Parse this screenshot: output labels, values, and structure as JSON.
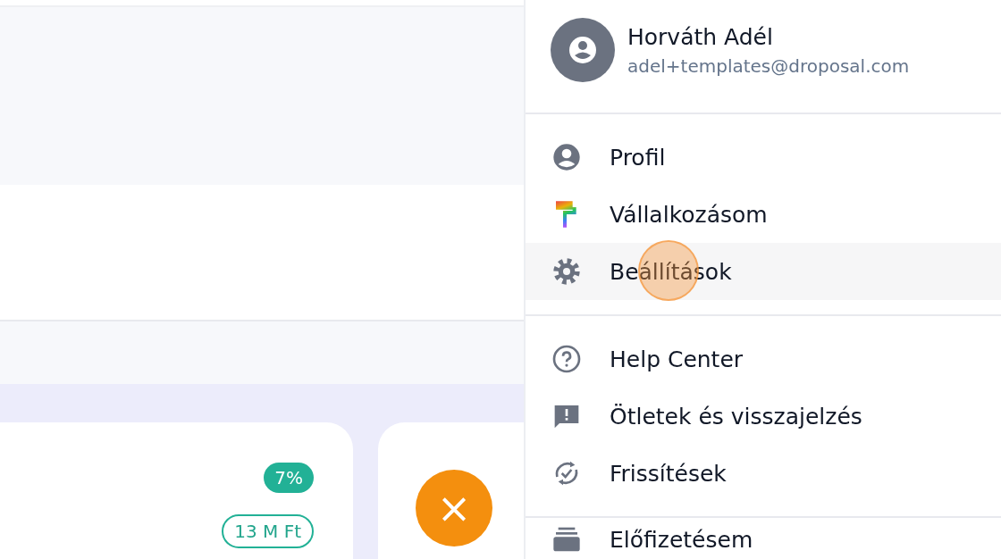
{
  "cards": [
    {
      "badges": [
        {
          "text": "7%",
          "kind": "filled"
        },
        {
          "text": "13 M Ft",
          "kind": "outlined"
        }
      ]
    },
    {
      "action": "×"
    }
  ],
  "account_menu": {
    "user": {
      "name": "Horváth Adél",
      "email": "adel+templates@droposal.com"
    },
    "sections": [
      [
        {
          "label": "Profil",
          "highlighted": false
        },
        {
          "label": "Vállalkozásom",
          "highlighted": false
        },
        {
          "label": "Beállítások",
          "highlighted": true
        }
      ],
      [
        {
          "label": "Help Center",
          "highlighted": false
        },
        {
          "label": "Ötletek és visszajelzés",
          "highlighted": false
        },
        {
          "label": "Frissítések",
          "highlighted": false
        }
      ],
      [
        {
          "label": "Előfizetésem",
          "highlighted": false
        }
      ]
    ]
  }
}
